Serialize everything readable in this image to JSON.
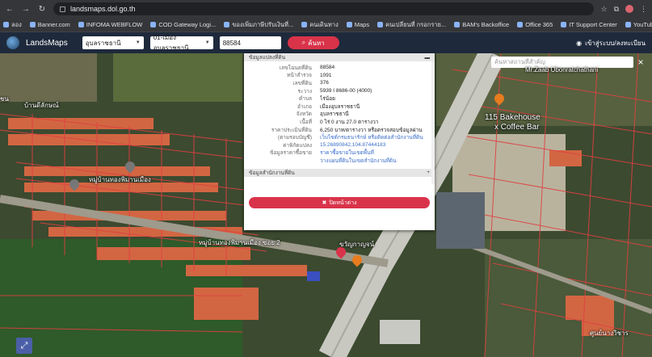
{
  "browser": {
    "url": "landsmaps.dol.go.th",
    "bookmarks": [
      "ลอง",
      "Banner.com",
      "INFOMA WEBFLOW",
      "COD Gateway Logi...",
      "ของเพิ่มภาษีปรับเงินที่...",
      "คนเดินทาง",
      "Maps",
      "คนเปลี่ยนที่ กรอกราย...",
      "BAM's Backoffice",
      "Office 365",
      "IT Support Center",
      "YouTube",
      "ข้อมูลเลข/จังหวัดการ"
    ]
  },
  "app": {
    "brand": "LandsMaps",
    "province": "อุบลราชธานี",
    "district": "01-เมืองอุบลราชธานี",
    "parcel_no": "88584",
    "search_label": "ค้นหา",
    "login_label": "เข้าสู่ระบบ/ลงทะเบียน"
  },
  "map": {
    "search_placeholder": "ค้นหาสถานที่สำคัญ",
    "pois": {
      "mr_zaab": "Mr.Zaab Ubonratchathani",
      "bakehouse_1": "115 Bakehouse",
      "bakehouse_2": "x Coffee Bar",
      "left_area": "บ้านดีลักษณ์",
      "village_1": "หมู่บ้านทองพิมานเมือง",
      "village_2": "หมู่บ้านทองพิมานเมือง ซอย 2",
      "market": "ขวัญกาญจน์",
      "edge_left": "ชน",
      "bottom_right": "ศูนย์นางวิชาร"
    }
  },
  "panel": {
    "section_title": "ข้อมูลแปลงที่ดิน",
    "rows": [
      {
        "k": "เลขโฉนดที่ดิน",
        "v": "88584"
      },
      {
        "k": "หน้าสำรวจ",
        "v": "1091"
      },
      {
        "k": "เลขที่ดิน",
        "v": "376"
      },
      {
        "k": "ระวาง",
        "v": "5939 I 8686-00 (4000)"
      },
      {
        "k": "ตำบล",
        "v": "ไร่น้อย"
      },
      {
        "k": "อำเภอ",
        "v": "เมืองอุบลราชธานี"
      },
      {
        "k": "จังหวัด",
        "v": "อุบลราชธานี"
      },
      {
        "k": "เนื้อที่",
        "v": "0 ไร่ 0 งาน 27.0 ตารางวา"
      },
      {
        "k": "ราคาประเมินที่ดิน",
        "v": "6,250 บาท/ตารางวา หรือตรวจสอบข้อมูลผ่าน"
      },
      {
        "k": "(ตามรอบบัญชี)",
        "v": "เว็บไซต์กรมธนารักษ์ หรือติดต่อสำนักงานที่ดิน"
      },
      {
        "k": "ค่าพิกัดแปลง",
        "v": "15.26890842,104.87444183"
      },
      {
        "k": "ข้อมูลราคาซื้อขาย",
        "v": "ราคาซื้อขายในเขตพื้นที่"
      },
      {
        "k": "",
        "v": "วางแผนที่ดินในเขตสำนักงานที่ดิน"
      }
    ],
    "section2_title": "ข้อมูลสำนักงานที่ดิน",
    "close_label": "ปิดหน้าต่าง"
  }
}
